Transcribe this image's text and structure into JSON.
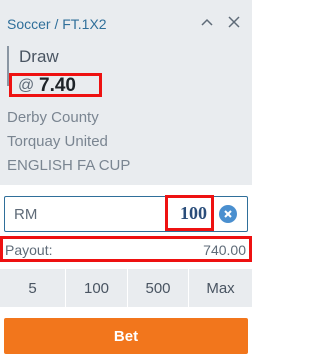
{
  "header": {
    "market_title": "Soccer / FT.1X2"
  },
  "selection": {
    "name": "Draw",
    "odds_prefix": "@",
    "odds": "7.40"
  },
  "event": {
    "home_team": "Derby County",
    "away_team": "Torquay United",
    "competition": "ENGLISH FA CUP"
  },
  "stake": {
    "currency": "RM",
    "value": "100"
  },
  "payout": {
    "label": "Payout:",
    "value": "740.00"
  },
  "quick_stakes": [
    "5",
    "100",
    "500",
    "Max"
  ],
  "bet_button_label": "Bet",
  "icons": {
    "collapse": "chevron-up-icon",
    "close": "close-icon",
    "clear": "clear-circle-icon"
  },
  "colors": {
    "accent_blue": "#2f6f9a",
    "highlight_red": "#ee1111",
    "bet_orange": "#f2761c",
    "card_gray": "#e9ecef"
  }
}
